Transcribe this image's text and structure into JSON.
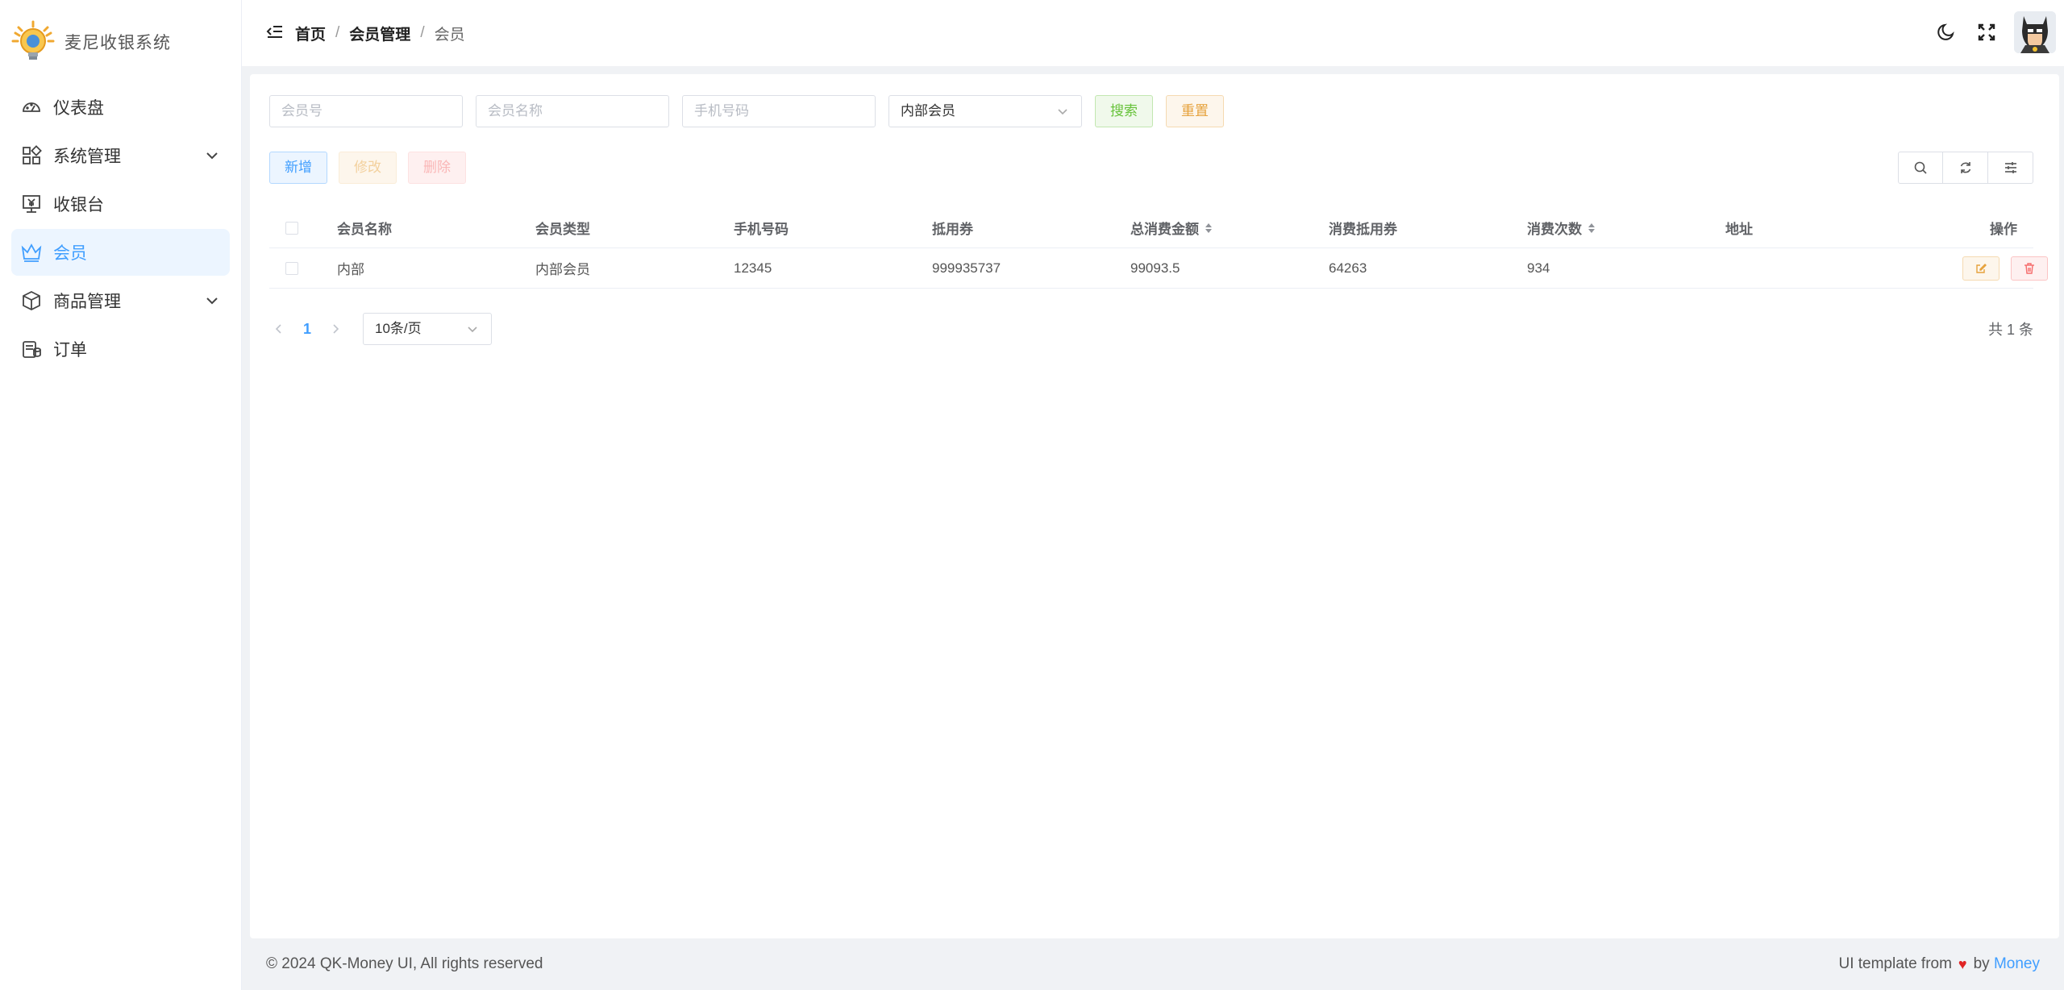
{
  "app": {
    "title": "麦尼收银系统"
  },
  "sidebar": {
    "items": [
      {
        "label": "仪表盘",
        "icon": "dashboard-icon",
        "active": false,
        "expandable": false
      },
      {
        "label": "系统管理",
        "icon": "apps-grid-icon",
        "active": false,
        "expandable": true
      },
      {
        "label": "收银台",
        "icon": "cashier-icon",
        "active": false,
        "expandable": false
      },
      {
        "label": "会员",
        "icon": "crown-icon",
        "active": true,
        "expandable": false
      },
      {
        "label": "商品管理",
        "icon": "box-icon",
        "active": false,
        "expandable": true
      },
      {
        "label": "订单",
        "icon": "order-icon",
        "active": false,
        "expandable": false
      }
    ]
  },
  "breadcrumb": {
    "items": [
      "首页",
      "会员管理",
      "会员"
    ]
  },
  "search": {
    "member_no_placeholder": "会员号",
    "member_name_placeholder": "会员名称",
    "phone_placeholder": "手机号码",
    "member_type_value": "内部会员",
    "search_label": "搜索",
    "reset_label": "重置"
  },
  "toolbar": {
    "add_label": "新增",
    "edit_label": "修改",
    "delete_label": "删除"
  },
  "table": {
    "headers": [
      "会员名称",
      "会员类型",
      "手机号码",
      "抵用券",
      "总消费金额",
      "消费抵用券",
      "消费次数",
      "地址",
      "操作"
    ],
    "rows": [
      {
        "name": "内部",
        "type": "内部会员",
        "phone": "12345",
        "voucher": "999935737",
        "total_spent": "99093.5",
        "voucher_used": "64263",
        "visit_count": "934",
        "address": ""
      }
    ]
  },
  "pagination": {
    "current_page": "1",
    "page_size": "10条/页",
    "total": "共 1 条"
  },
  "footer": {
    "copyright": "© 2024 QK-Money UI, All rights reserved",
    "credit_prefix": "UI template from",
    "credit_by": "by",
    "credit_link": "Money"
  },
  "colors": {
    "primary": "#409eff",
    "success": "#67c23a",
    "warning": "#e6a23c",
    "danger": "#f56c6c"
  }
}
